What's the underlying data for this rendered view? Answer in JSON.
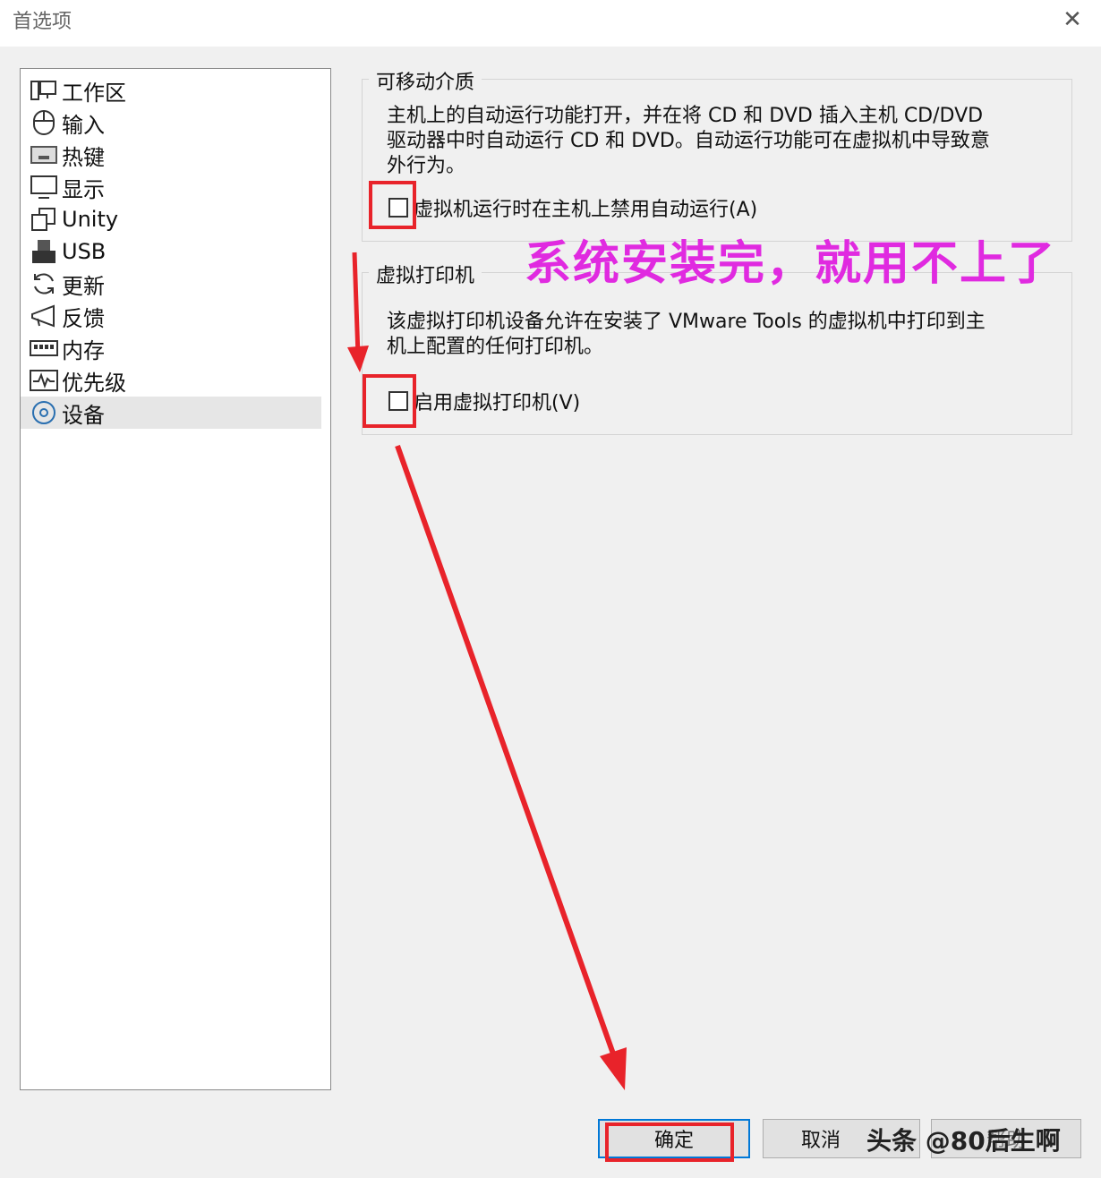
{
  "window": {
    "title": "首选项"
  },
  "nav": {
    "items": [
      {
        "label": "工作区",
        "icon": "workspace-icon"
      },
      {
        "label": "输入",
        "icon": "mouse-icon"
      },
      {
        "label": "热键",
        "icon": "keyboard-icon"
      },
      {
        "label": "显示",
        "icon": "monitor-icon"
      },
      {
        "label": "Unity",
        "icon": "unity-icon"
      },
      {
        "label": "USB",
        "icon": "usb-icon"
      },
      {
        "label": "更新",
        "icon": "refresh-icon"
      },
      {
        "label": "反馈",
        "icon": "megaphone-icon"
      },
      {
        "label": "内存",
        "icon": "memory-icon"
      },
      {
        "label": "优先级",
        "icon": "priority-icon"
      },
      {
        "label": "设备",
        "icon": "disc-icon"
      }
    ],
    "selected": "设备"
  },
  "removable": {
    "legend": "可移动介质",
    "description_lines": [
      "主机上的自动运行功能打开，并在将 CD 和 DVD 插入主机 CD/DVD",
      "驱动器中时自动运行 CD 和 DVD。自动运行功能可在虚拟机中导致意",
      "外行为。"
    ],
    "checkbox_label": "虚拟机运行时在主机上禁用自动运行(A)",
    "checked": false
  },
  "printer": {
    "legend": "虚拟打印机",
    "description_lines": [
      "该虚拟打印机设备允许在安装了 VMware Tools 的虚拟机中打印到主",
      "机上配置的任何打印机。"
    ],
    "checkbox_label": "启用虚拟打印机(V)",
    "checked": false
  },
  "annotation": "系统安装完，就用不上了",
  "buttons": {
    "ok": "确定",
    "cancel": "取消",
    "help": "帮助"
  },
  "watermark": "头条 @80后生啊",
  "colors": {
    "highlight": "#e8232a",
    "annotation": "#e02ae0",
    "accent": "#0078d7"
  }
}
